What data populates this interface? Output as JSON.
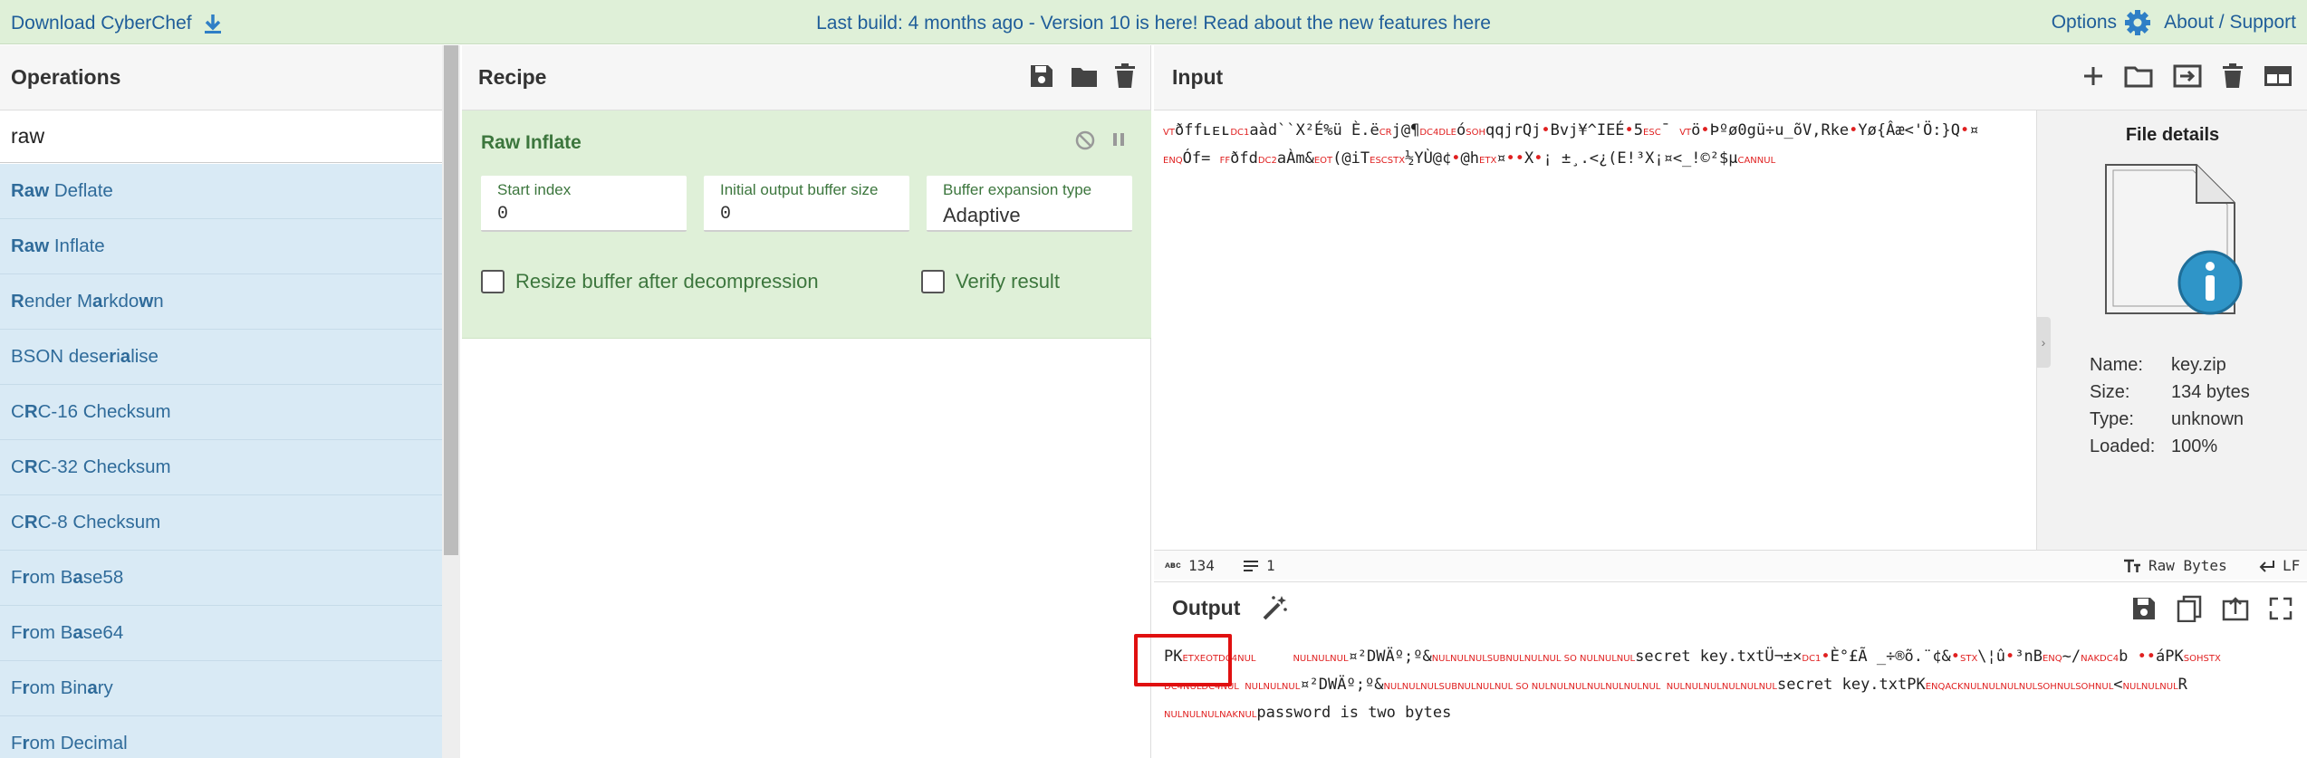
{
  "banner": {
    "download_label": "Download CyberChef",
    "center_text": "Last build: 4 months ago - Version 10 is here! Read about the new features ",
    "center_link": "here",
    "options_label": "Options",
    "about_label": "About / Support"
  },
  "operations": {
    "title": "Operations",
    "search_value": "raw",
    "items": [
      {
        "hl": "Raw",
        "rest": " Deflate"
      },
      {
        "hl": "Raw",
        "rest": " Inflate"
      },
      {
        "html": "<b>R</b>ender M<b>a</b>rkdo<b>w</b>n"
      },
      {
        "html": "BSON dese<b>r</b>i<b>a</b>lise"
      },
      {
        "html": "C<b>R</b>C-16 Checksum"
      },
      {
        "html": "C<b>R</b>C-32 Checksum"
      },
      {
        "html": "C<b>R</b>C-8 Checksum"
      },
      {
        "html": "F<b>r</b>om B<b>a</b>se58"
      },
      {
        "html": "F<b>r</b>om B<b>a</b>se64"
      },
      {
        "html": "F<b>r</b>om Bin<b>a</b>ry"
      },
      {
        "html": "F<b>r</b>om Decimal"
      }
    ]
  },
  "recipe": {
    "title": "Recipe",
    "operation_name": "Raw Inflate",
    "fields": {
      "start_index_label": "Start index",
      "start_index_value": "0",
      "initial_buffer_label": "Initial output buffer size",
      "initial_buffer_value": "0",
      "expansion_label": "Buffer expansion type",
      "expansion_value": "Adaptive"
    },
    "checkbox_resize": "Resize buffer after decompression",
    "checkbox_verify": "Verify result"
  },
  "input": {
    "title": "Input",
    "file_details": {
      "title": "File details",
      "name_label": "Name:",
      "name_value": "key.zip",
      "size_label": "Size:",
      "size_value": "134 bytes",
      "type_label": "Type:",
      "type_value": "unknown",
      "loaded_label": "Loaded:",
      "loaded_value": "100%"
    },
    "status": {
      "char_count": "134",
      "line_count": "1",
      "encoding": "Raw Bytes",
      "eol": "LF"
    }
  },
  "output": {
    "title": "Output",
    "tail_text": "password is two bytes"
  },
  "colors": {
    "banner_bg": "#dff0d8",
    "link": "#1f5d99",
    "op_list_bg": "#d9eaf5",
    "ingredient_bg": "#dff0d8",
    "control_char": "#e02020",
    "highlight_box": "#e01010"
  }
}
